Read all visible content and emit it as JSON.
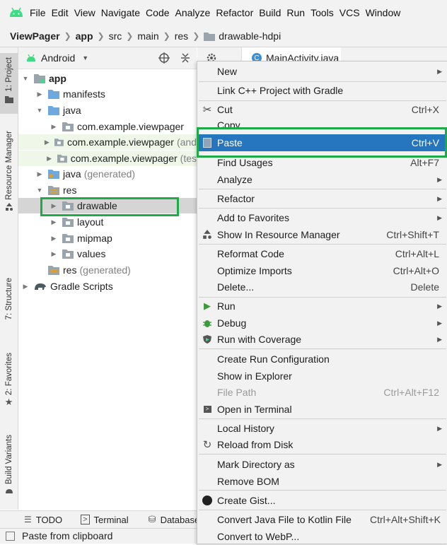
{
  "menubar": {
    "items": [
      "File",
      "Edit",
      "View",
      "Navigate",
      "Code",
      "Analyze",
      "Refactor",
      "Build",
      "Run",
      "Tools",
      "VCS",
      "Window"
    ]
  },
  "breadcrumb": {
    "items": [
      "ViewPager",
      "app",
      "src",
      "main",
      "res",
      "drawable-hdpi"
    ]
  },
  "left_strip": {
    "project": "1: Project",
    "resource_manager": "Resource Manager",
    "structure": "7: Structure",
    "favorites": "2: Favorites",
    "build_variants": "Build Variants"
  },
  "project_panel": {
    "view_mode": "Android"
  },
  "tree": {
    "app": "app",
    "manifests": "manifests",
    "java": "java",
    "pkg1": "com.example.viewpager",
    "pkg2": "com.example.viewpager",
    "pkg2_suffix": "(and",
    "pkg3": "com.example.viewpager",
    "pkg3_suffix": "(tes",
    "java_gen": "java",
    "java_gen_suffix": "(generated)",
    "res": "res",
    "drawable": "drawable",
    "layout": "layout",
    "mipmap": "mipmap",
    "values": "values",
    "res_gen": "res",
    "res_gen_suffix": "(generated)",
    "gradle": "Gradle Scripts"
  },
  "editor_tab": {
    "label": "MainActivity.java"
  },
  "context_menu": {
    "new": "New",
    "link_cpp": "Link C++ Project with Gradle",
    "cut": "Cut",
    "cut_sc": "Ctrl+X",
    "copy": "Copy",
    "paste": "Paste",
    "paste_sc": "Ctrl+V",
    "find_usages": "Find Usages",
    "find_usages_sc": "Alt+F7",
    "analyze": "Analyze",
    "refactor": "Refactor",
    "add_favorites": "Add to Favorites",
    "show_resource_manager": "Show In Resource Manager",
    "show_resource_manager_sc": "Ctrl+Shift+T",
    "reformat": "Reformat Code",
    "reformat_sc": "Ctrl+Alt+L",
    "optimize": "Optimize Imports",
    "optimize_sc": "Ctrl+Alt+O",
    "delete": "Delete...",
    "delete_sc": "Delete",
    "run": "Run",
    "debug": "Debug",
    "run_coverage": "Run with Coverage",
    "create_run_config": "Create Run Configuration",
    "show_explorer": "Show in Explorer",
    "file_path": "File Path",
    "file_path_sc": "Ctrl+Alt+F12",
    "open_terminal": "Open in Terminal",
    "local_history": "Local History",
    "reload_disk": "Reload from Disk",
    "mark_dir": "Mark Directory as",
    "remove_bom": "Remove BOM",
    "create_gist": "Create Gist...",
    "convert_kotlin": "Convert Java File to Kotlin File",
    "convert_kotlin_sc": "Ctrl+Alt+Shift+K",
    "convert_webp": "Convert to WebP..."
  },
  "bottom_tabs": {
    "todo": "TODO",
    "terminal": "Terminal",
    "database": "Database"
  },
  "status": {
    "text": "Paste from clipboard"
  },
  "colors": {
    "selection": "#2675bf",
    "highlight_box": "#1faa48",
    "folder_blue": "#6fa8dc",
    "android_green": "#3ddc84"
  }
}
